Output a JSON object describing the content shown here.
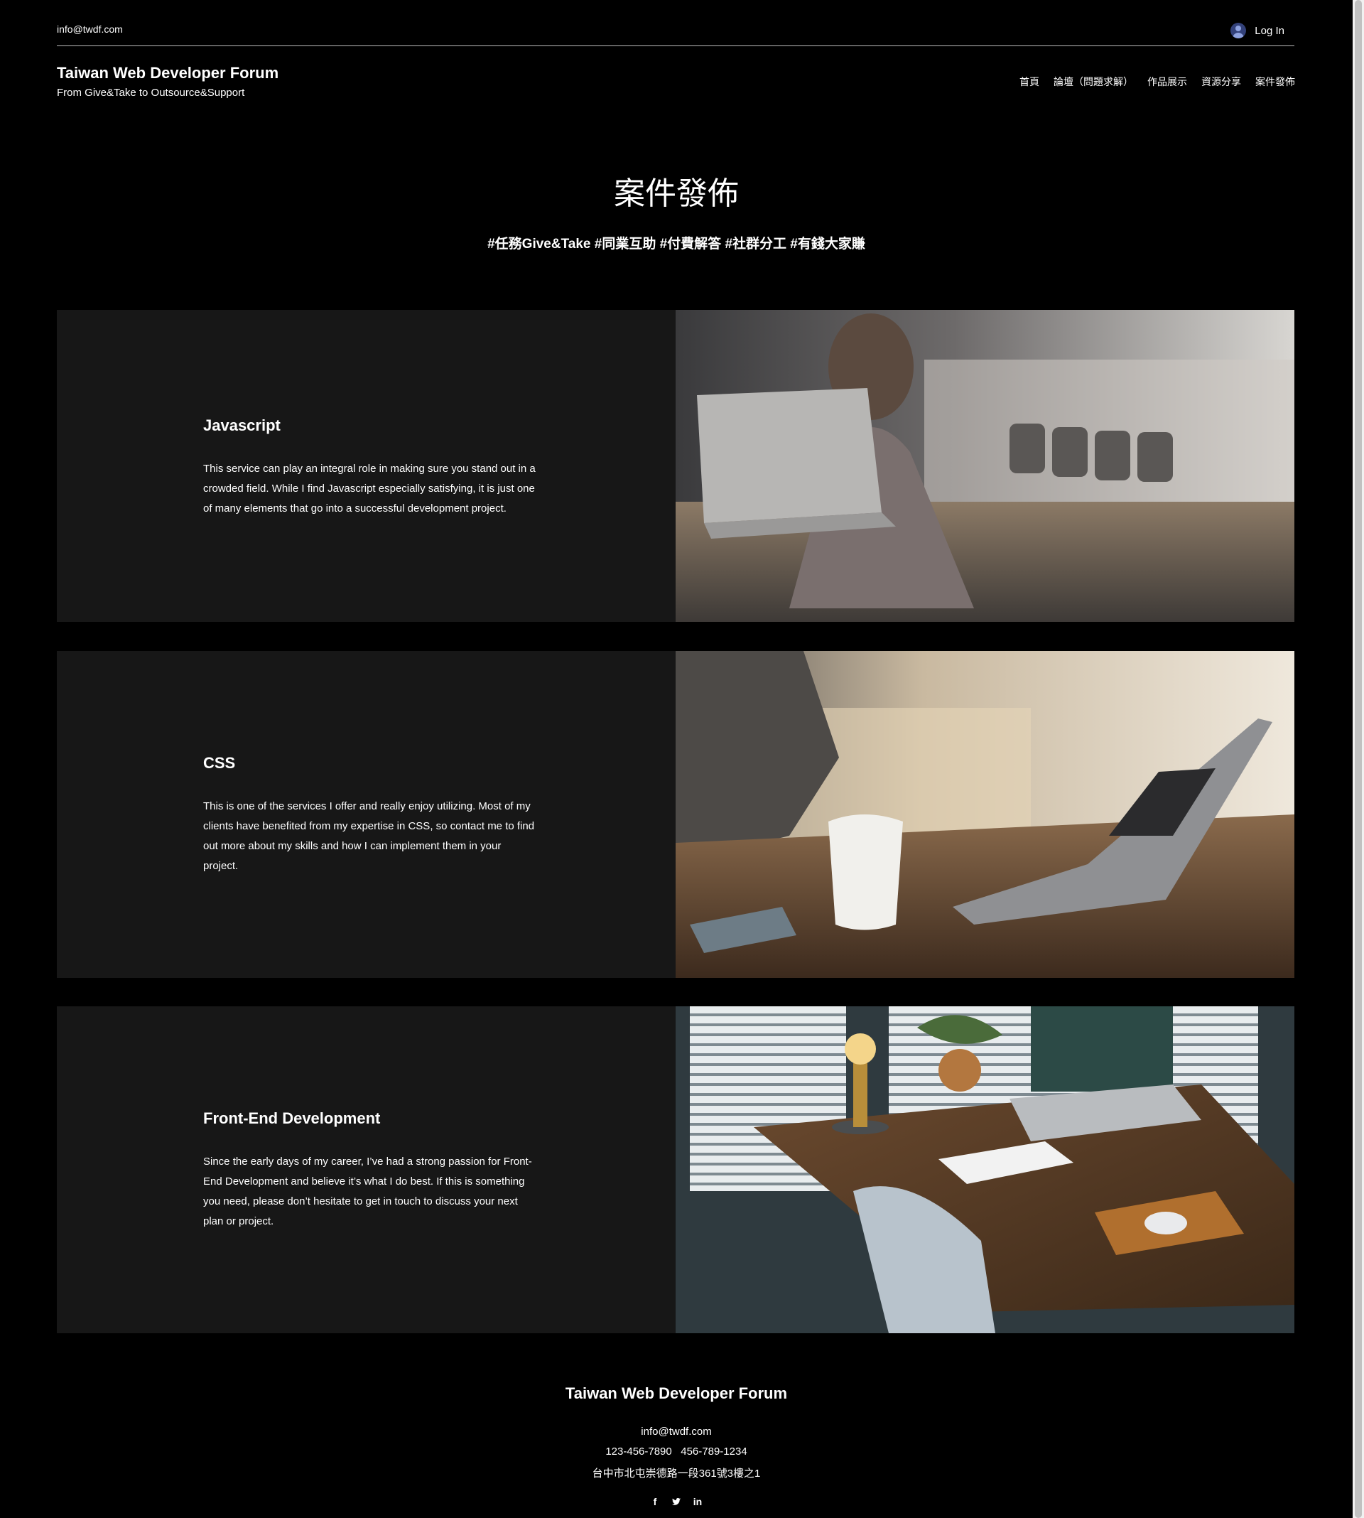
{
  "header": {
    "email": "info@twdf.com",
    "login_label": "Log In",
    "site_title": "Taiwan Web Developer Forum",
    "tagline": "From Give&Take to Outsource&Support",
    "nav": [
      "首頁",
      "論壇（問題求解）",
      "作品展示",
      "資源分享",
      "案件發佈"
    ]
  },
  "hero": {
    "title": "案件發佈",
    "hashtags": "#任務Give&Take #同業互助 #付費解答 #社群分工 #有錢大家賺"
  },
  "services": [
    {
      "title": "Javascript",
      "description": "This service can play an integral role in making sure you stand out in a crowded field. While I find Javascript especially satisfying, it is just one of many elements that go into a successful development project.",
      "image": "person-with-headphones-at-laptop"
    },
    {
      "title": "CSS",
      "description": "This is one of the services I offer and really enjoy utilizing. Most of my clients have benefited from my expertise in CSS, so contact me to find out more about my skills and how I can implement them in your project.",
      "image": "typing-on-laptop-with-coffee-mug"
    },
    {
      "title": "Front-End Development",
      "description": "Since the early days of my career, I’ve had a strong passion for Front-End Development and believe it’s what I do best. If this is something you need, please don’t hesitate to get in touch to discuss your next plan or project.",
      "image": "desk-with-laptop-lamp-plants"
    }
  ],
  "footer": {
    "title": "Taiwan Web Developer Forum",
    "email": "info@twdf.com",
    "phones": "123-456-7890   456-789-1234",
    "address": "台中市北屯崇德路一段361號3樓之1",
    "social": [
      "facebook-icon",
      "twitter-icon",
      "linkedin-icon"
    ]
  },
  "colors": {
    "background": "#000000",
    "panel": "#171717",
    "text": "#ffffff",
    "avatar": "#33417a"
  }
}
